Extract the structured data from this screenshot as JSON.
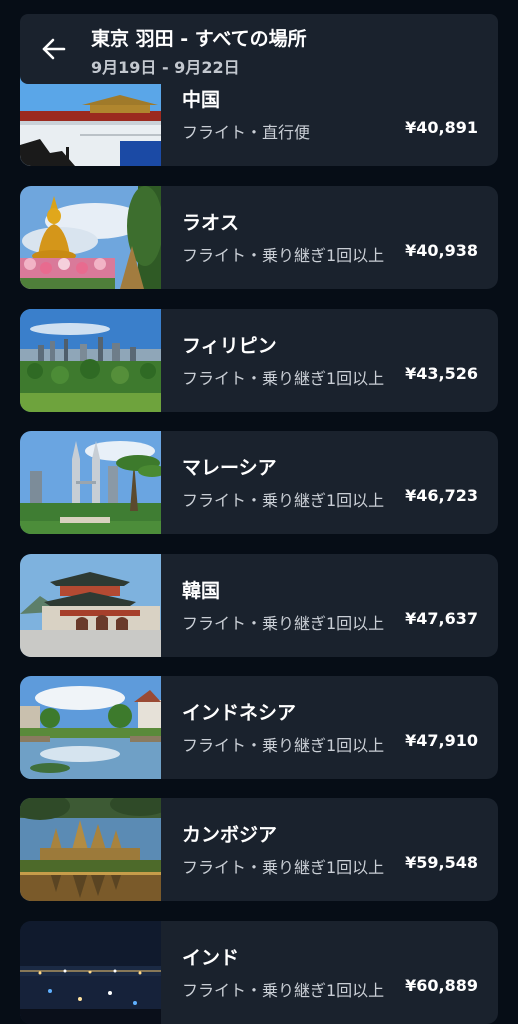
{
  "header": {
    "title": "東京 羽田 - すべての場所",
    "dates": "9月19日 - 9月22日"
  },
  "results": [
    {
      "name": "中国",
      "info": "フライト・直行便",
      "price": "¥40,891",
      "image": "forbidden-city"
    },
    {
      "name": "ラオス",
      "info": "フライト・乗り継ぎ1回以上",
      "price": "¥40,938",
      "image": "golden-buddha"
    },
    {
      "name": "フィリピン",
      "info": "フライト・乗り継ぎ1回以上",
      "price": "¥43,526",
      "image": "city-skyline-park"
    },
    {
      "name": "マレーシア",
      "info": "フライト・乗り継ぎ1回以上",
      "price": "¥46,723",
      "image": "twin-towers"
    },
    {
      "name": "韓国",
      "info": "フライト・乗り継ぎ1回以上",
      "price": "¥47,637",
      "image": "palace-gate"
    },
    {
      "name": "インドネシア",
      "info": "フライト・乗り継ぎ1回以上",
      "price": "¥47,910",
      "image": "canal-town"
    },
    {
      "name": "カンボジア",
      "info": "フライト・乗り継ぎ1回以上",
      "price": "¥59,548",
      "image": "angkor-wat"
    },
    {
      "name": "インド",
      "info": "フライト・乗り継ぎ1回以上",
      "price": "¥60,889",
      "image": "night-city"
    }
  ],
  "colors": {
    "background": "#060d16",
    "card": "#1a222d",
    "text_primary": "#ffffff",
    "text_secondary": "#c9ced5"
  },
  "icons": {
    "back": "arrow-left-icon"
  }
}
